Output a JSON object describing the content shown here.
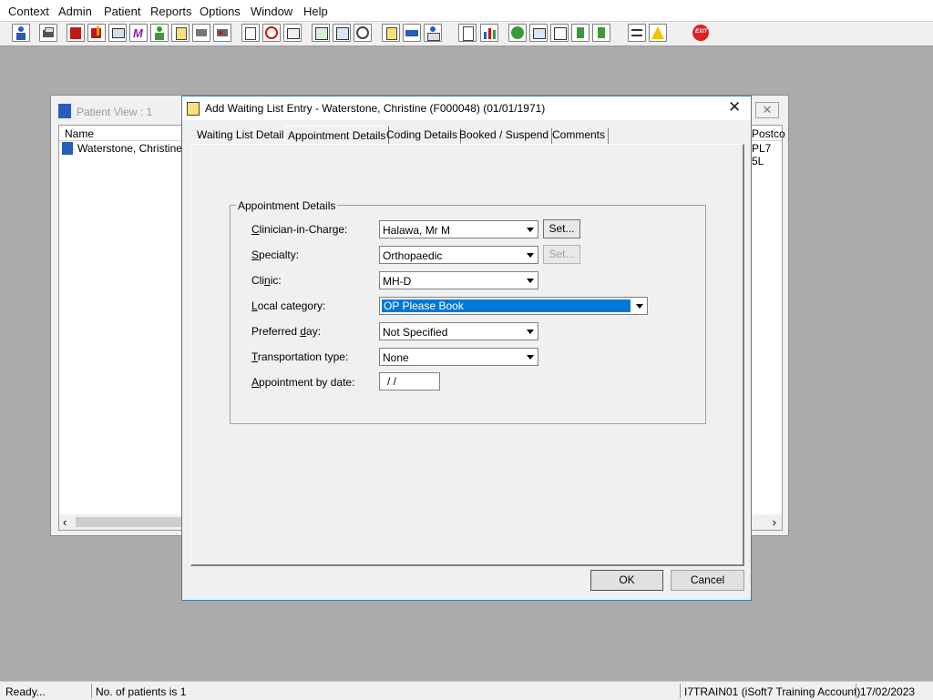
{
  "menu": [
    "Context",
    "Admin",
    "Patient",
    "Reports",
    "Options",
    "Window",
    "Help"
  ],
  "toolbar_icons": [
    "person-icon",
    "printer-icon",
    "book-icon",
    "edit-icon",
    "monitor-icon",
    "m-icon",
    "doctor-icon",
    "notes-icon",
    "flag-icon",
    "flag2-icon",
    "search-doc-icon",
    "clock-icon",
    "screen-icon",
    "form-icon",
    "form2-icon",
    "dial-icon",
    "notepad-icon",
    "ambulance-icon",
    "list-person-icon",
    "document-icon",
    "chart-icon",
    "globe-icon",
    "inbox-icon",
    "check-doc-icon",
    "download-icon",
    "upload-icon",
    "swap-icon",
    "warning-icon",
    "exit-icon"
  ],
  "patient_view": {
    "title": "Patient View : 1",
    "col_name": "Name",
    "col_postcode": "Postco",
    "row_name": "Waterstone, Christine...",
    "row_postcode": "PL7 5L"
  },
  "dialog": {
    "title": "Add Waiting List Entry - Waterstone, Christine (F000048) (01/01/1971)",
    "tabs": [
      "Waiting List Details",
      "Appointment Details",
      "Coding Details",
      "Booked / Suspend",
      "Comments"
    ],
    "group_title": "Appointment Details",
    "fields": {
      "clinician": {
        "label": "Clinician-in-Charge:",
        "value": "Halawa, Mr M"
      },
      "specialty": {
        "label": "Specialty:",
        "value": "Orthopaedic"
      },
      "clinic": {
        "label": "Clinic:",
        "value": "MH-D"
      },
      "local_category": {
        "label": "Local category:",
        "value": "OP Please Book"
      },
      "preferred_day": {
        "label": "Preferred day:",
        "value": "Not Specified"
      },
      "transportation": {
        "label": "Transportation type:",
        "value": "None"
      },
      "appt_by_date": {
        "label": "Appointment by date:",
        "value": " /  /"
      }
    },
    "set_label": "Set...",
    "ok_label": "OK",
    "cancel_label": "Cancel"
  },
  "status": {
    "ready": "Ready...",
    "patients": "No. of patients is 1",
    "account": "I7TRAIN01 (iSoft7 Training Account)",
    "date": "17/02/2023"
  },
  "colors": {
    "selection": "#0078d7",
    "desktop": "#ababab",
    "exit": "#e02020"
  }
}
